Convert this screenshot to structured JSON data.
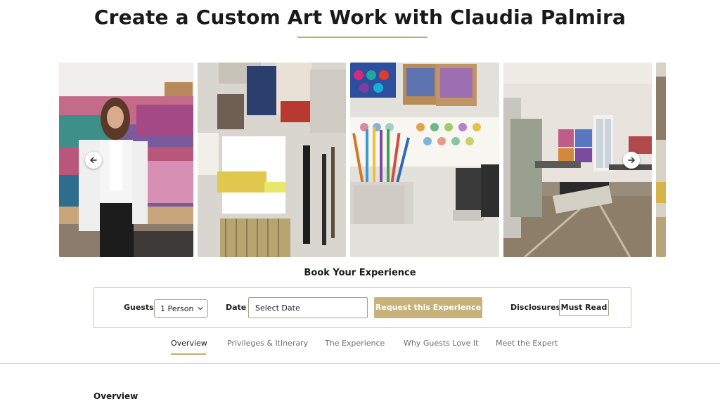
{
  "page": {
    "title": "Create a Custom Art Work with Claudia Palmira"
  },
  "gallery": {
    "prev_icon": "arrow-left-icon",
    "next_icon": "arrow-right-icon"
  },
  "booking": {
    "heading": "Book Your Experience",
    "guests_label": "Guests",
    "guests_value": "1 Person",
    "date_label": "Date",
    "date_value": "Select Date",
    "request_label": "Request this Experience",
    "disclosures_label": "Disclosures",
    "disclosures_button": "Must Read"
  },
  "tabs": [
    {
      "label": "Overview",
      "active": true
    },
    {
      "label": "Privileges & Itinerary",
      "active": false
    },
    {
      "label": "The Experience",
      "active": false
    },
    {
      "label": "Why Guests Love It",
      "active": false
    },
    {
      "label": "Meet the Expert",
      "active": false
    }
  ],
  "section": {
    "heading": "Overview"
  },
  "colors": {
    "accent": "#c4ad6d",
    "button": "#c7b27c",
    "border": "#d4c79f"
  }
}
